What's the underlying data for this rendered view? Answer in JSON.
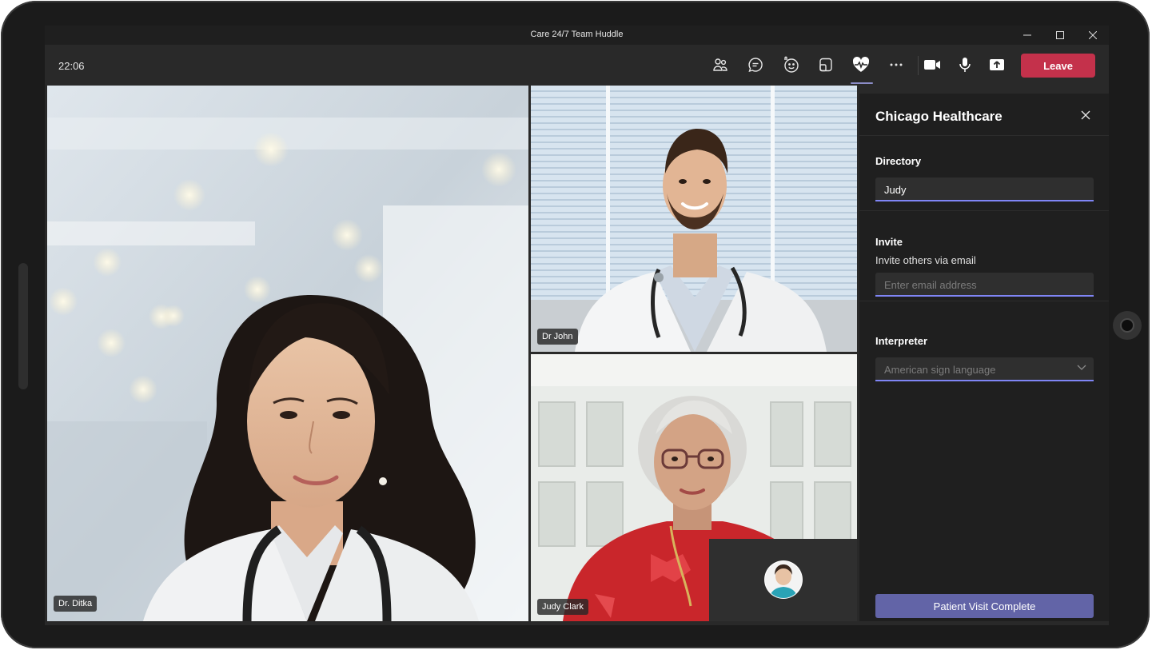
{
  "window": {
    "title": "Care 24/7 Team Huddle"
  },
  "toolbar": {
    "clock": "22:06",
    "icons": [
      "participants-icon",
      "chat-icon",
      "reactions-icon",
      "share-tray-icon",
      "health-app-icon",
      "more-options-icon",
      "camera-icon",
      "microphone-icon",
      "share-screen-icon"
    ],
    "leave_label": "Leave",
    "leave_color": "#c4314b"
  },
  "participants": [
    {
      "name": "Dr. Ditka"
    },
    {
      "name": "Dr John"
    },
    {
      "name": "Judy Clark"
    }
  ],
  "panel": {
    "title": "Chicago Healthcare",
    "directory": {
      "label": "Directory",
      "value": "Judy"
    },
    "invite": {
      "label": "Invite",
      "subtitle": "Invite others via email",
      "placeholder": "Enter email address"
    },
    "interpreter": {
      "label": "Interpreter",
      "selected": "American sign language"
    },
    "complete_label": "Patient Visit Complete",
    "accent_color": "#6264a7"
  }
}
